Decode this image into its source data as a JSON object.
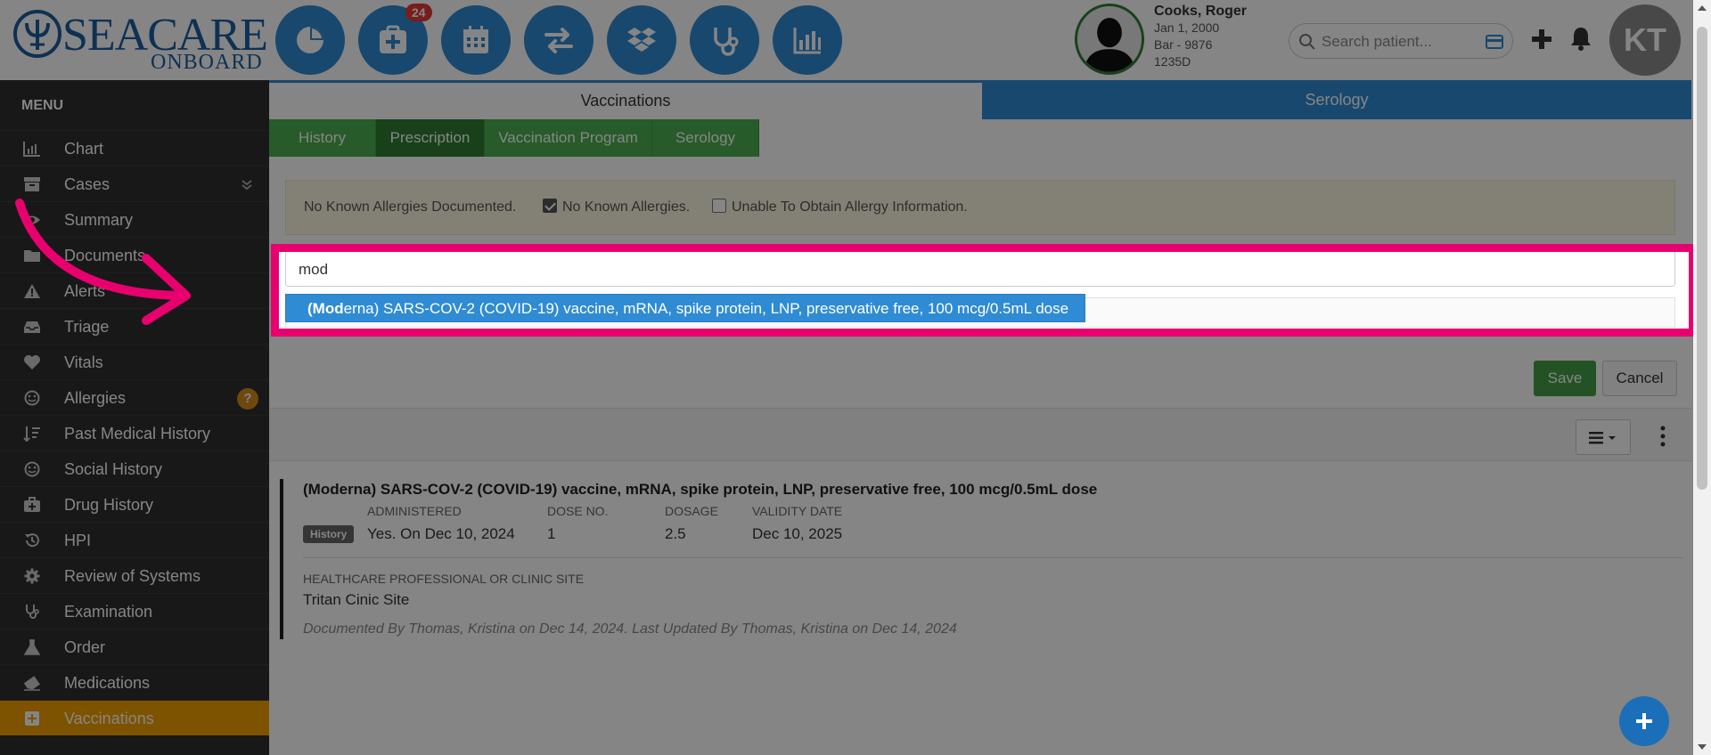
{
  "brand": {
    "line1": "SEACARE",
    "line2": "ONBOARD"
  },
  "nav": {
    "badge_count": "24",
    "buttons": [
      "chart-pie-icon",
      "medical-plus-icon",
      "calendar-icon",
      "exchange-icon",
      "dropbox-icon",
      "stethoscope-icon",
      "bar-chart-icon"
    ]
  },
  "patient": {
    "name": "Cooks, Roger",
    "dob": "Jan 1, 2000",
    "id": "Bar - 9876",
    "room": "1235D"
  },
  "search": {
    "placeholder": "Search patient..."
  },
  "user": {
    "initials": "KT"
  },
  "sidebar": {
    "title": "MENU",
    "items": [
      {
        "label": "Chart",
        "icon": "bar-chart-icon"
      },
      {
        "label": "Cases",
        "icon": "archive-icon"
      },
      {
        "label": "Summary",
        "icon": "eye-icon"
      },
      {
        "label": "Documents",
        "icon": "folder-icon"
      },
      {
        "label": "Alerts",
        "icon": "warning-icon"
      },
      {
        "label": "Triage",
        "icon": "inbox-icon"
      },
      {
        "label": "Vitals",
        "icon": "heart-icon"
      },
      {
        "label": "Allergies",
        "icon": "smile-icon",
        "badge": "?"
      },
      {
        "label": "Past Medical History",
        "icon": "sort-icon"
      },
      {
        "label": "Social History",
        "icon": "smile-icon"
      },
      {
        "label": "Drug History",
        "icon": "medkit-icon"
      },
      {
        "label": "HPI",
        "icon": "history-icon"
      },
      {
        "label": "Review of Systems",
        "icon": "cog-icon"
      },
      {
        "label": "Examination",
        "icon": "stethoscope-icon"
      },
      {
        "label": "Order",
        "icon": "flask-icon"
      },
      {
        "label": "Medications",
        "icon": "eraser-icon"
      },
      {
        "label": "Vaccinations",
        "icon": "plus-square-icon"
      }
    ]
  },
  "tabs": {
    "vaccinations": "Vaccinations",
    "serology": "Serology"
  },
  "subtabs": [
    "History",
    "Prescription",
    "Vaccination Program",
    "Serology"
  ],
  "allergy": {
    "status": "No Known Allergies Documented.",
    "nka_label": "No Known Allergies.",
    "unable_label": "Unable To Obtain Allergy Information."
  },
  "medication_input": {
    "value": "mod"
  },
  "suggestion": {
    "match": "(Mod",
    "rest": "erna) SARS-COV-2 (COVID-19) vaccine, mRNA, spike protein, LNP, preservative free, 100 mcg/0.5mL dose"
  },
  "buttons": {
    "save": "Save",
    "cancel": "Cancel"
  },
  "record": {
    "title": "(Moderna) SARS-COV-2 (COVID-19) vaccine, mRNA, spike protein, LNP, preservative free, 100 mcg/0.5mL dose",
    "badge": "History",
    "headers": {
      "administered": "ADMINISTERED",
      "dose_no": "DOSE NO.",
      "dosage": "DOSAGE",
      "validity": "VALIDITY DATE"
    },
    "values": {
      "administered": "Yes. On Dec 10, 2024",
      "dose_no": "1",
      "dosage": "2.5",
      "validity": "Dec 10, 2025"
    },
    "site_label": "HEALTHCARE PROFESSIONAL OR CLINIC SITE",
    "site_value": "Tritan Cinic Site",
    "documented": "Documented By Thomas, Kristina on Dec 14, 2024. Last Updated By Thomas, Kristina on Dec 14, 2024"
  },
  "colors": {
    "primary": "#2f8bd3",
    "green": "#4caf50",
    "active_menu": "#f0a000",
    "highlight": "#e8006f"
  }
}
